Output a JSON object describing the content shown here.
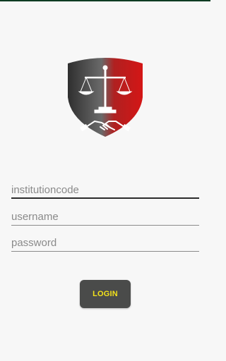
{
  "logo": {
    "icon": "justice-shield-logo-icon"
  },
  "form": {
    "institution_placeholder": "institutioncode",
    "username_placeholder": "username",
    "password_placeholder": "password"
  },
  "login_button": {
    "label": "LOGIN"
  },
  "colors": {
    "accent_red": "#d41616",
    "button_bg": "#4a4b4a",
    "button_text": "#f2e11b",
    "status_bar": "#0d3b22"
  }
}
